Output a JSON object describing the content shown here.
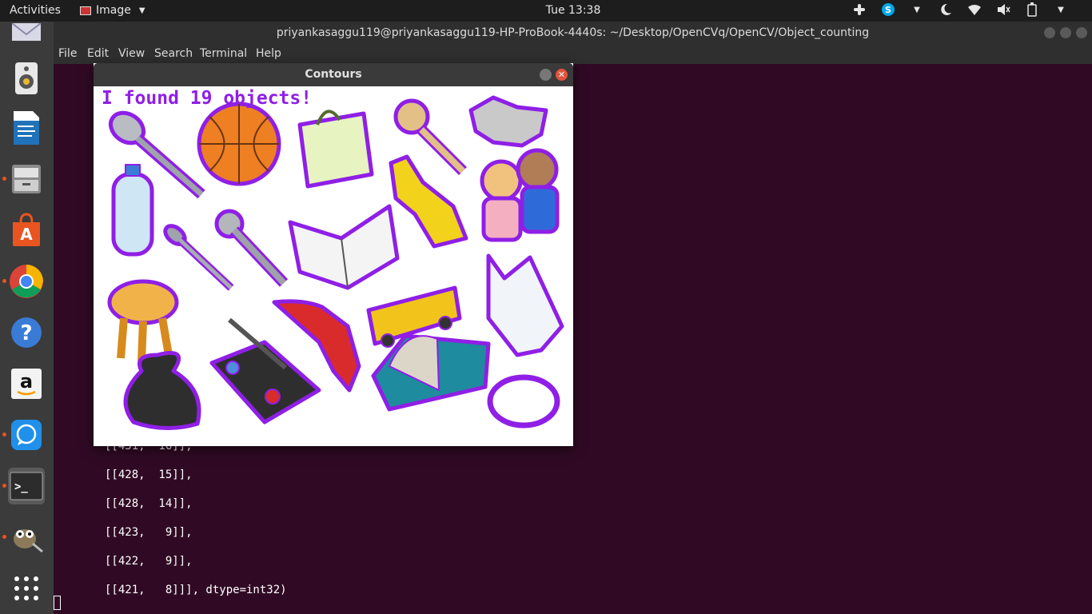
{
  "topbar": {
    "activities": "Activities",
    "app_name": "Image",
    "clock": "Tue 13:38"
  },
  "dock": {
    "apps": [
      "mail-icon",
      "speaker-icon",
      "writer-icon",
      "files-icon",
      "app-store-icon",
      "chrome-icon",
      "help-icon",
      "amazon-icon",
      "signal-icon",
      "terminal-icon",
      "gimp-icon",
      "app-grid-icon"
    ]
  },
  "terminal": {
    "title": "priyankasaggu119@priyankasaggu119-HP-ProBook-4440s: ~/Desktop/OpenCVq/OpenCV/Object_counting",
    "menu": [
      "File",
      "Edit",
      "View",
      "Search",
      "Terminal",
      "Help"
    ],
    "lines": [
      "[[431,  16]],",
      "[[428,  15]],",
      "[[428,  14]],",
      "[[423,   9]],",
      "[[422,   9]],",
      "[[421,   8]]], dtype=int32)"
    ]
  },
  "contours_window": {
    "title": "Contours",
    "caption": "I found 19 objects!",
    "contour_color": "#8f1fe6"
  }
}
